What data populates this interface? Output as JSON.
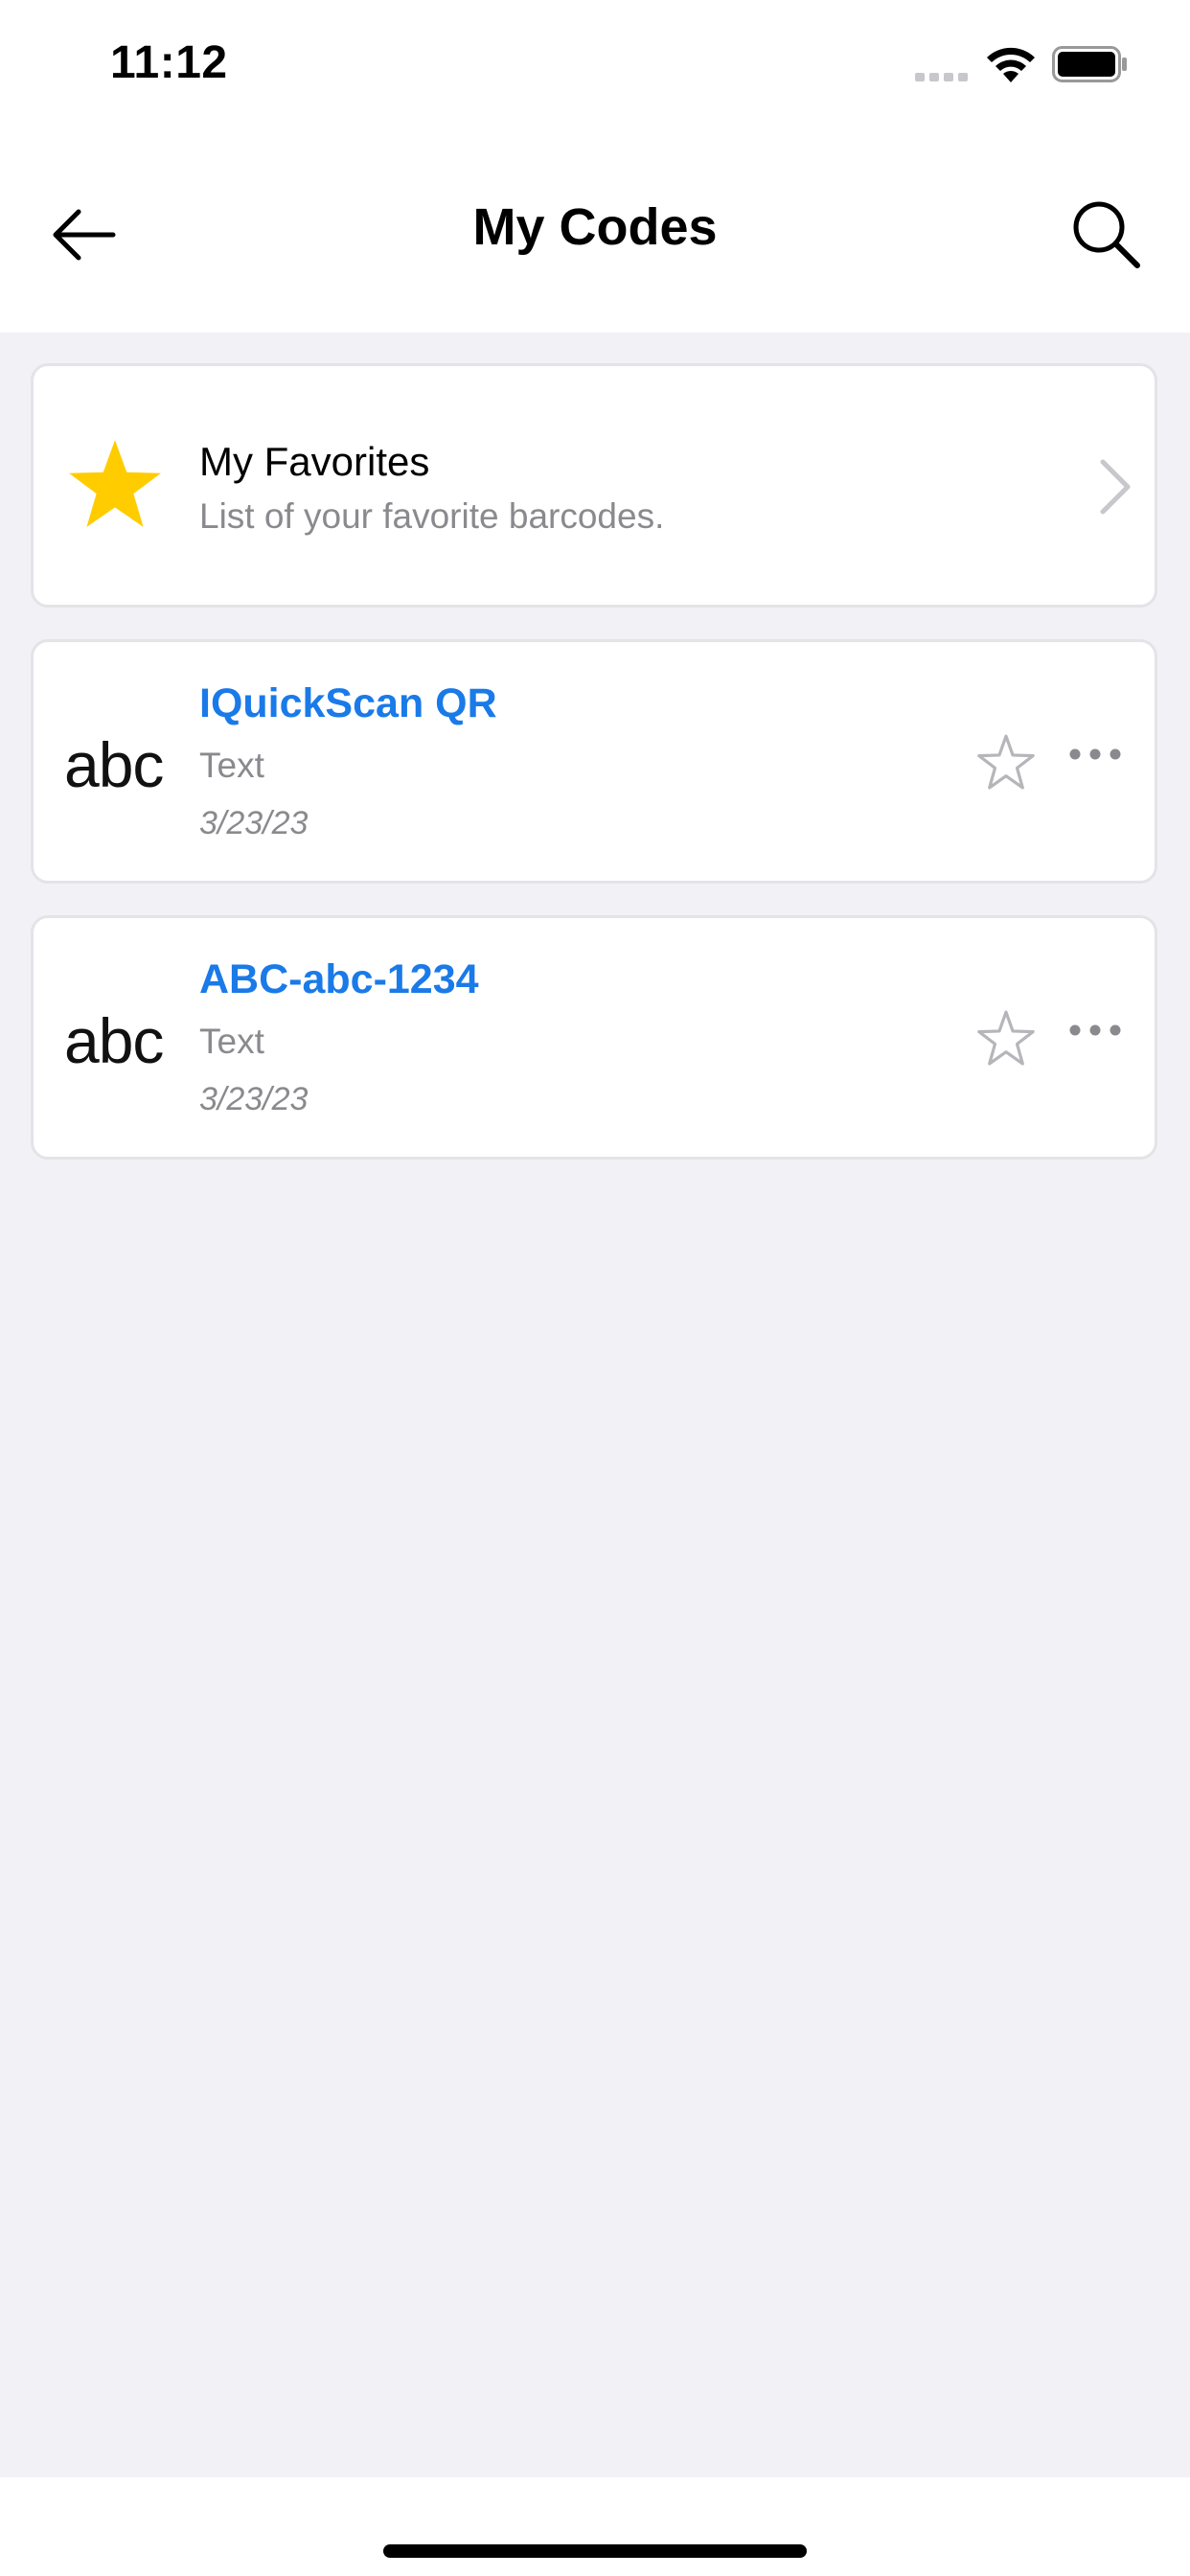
{
  "status_bar": {
    "time": "11:12"
  },
  "nav": {
    "title": "My Codes",
    "back_icon": "arrow-left-icon",
    "search_icon": "search-icon"
  },
  "favorites": {
    "title": "My Favorites",
    "subtitle": "List of your favorite barcodes.",
    "icon": "star-filled-icon",
    "icon_color": "#ffcc00"
  },
  "codes": [
    {
      "icon_text": "abc",
      "title": "IQuickScan QR",
      "type": "Text",
      "date": "3/23/23",
      "favorite": false
    },
    {
      "icon_text": "abc",
      "title": "ABC-abc-1234",
      "type": "Text",
      "date": "3/23/23",
      "favorite": false
    }
  ],
  "colors": {
    "accent": "#1a7ae8",
    "background": "#f1f1f6",
    "secondary_text": "#8a8a8e"
  }
}
